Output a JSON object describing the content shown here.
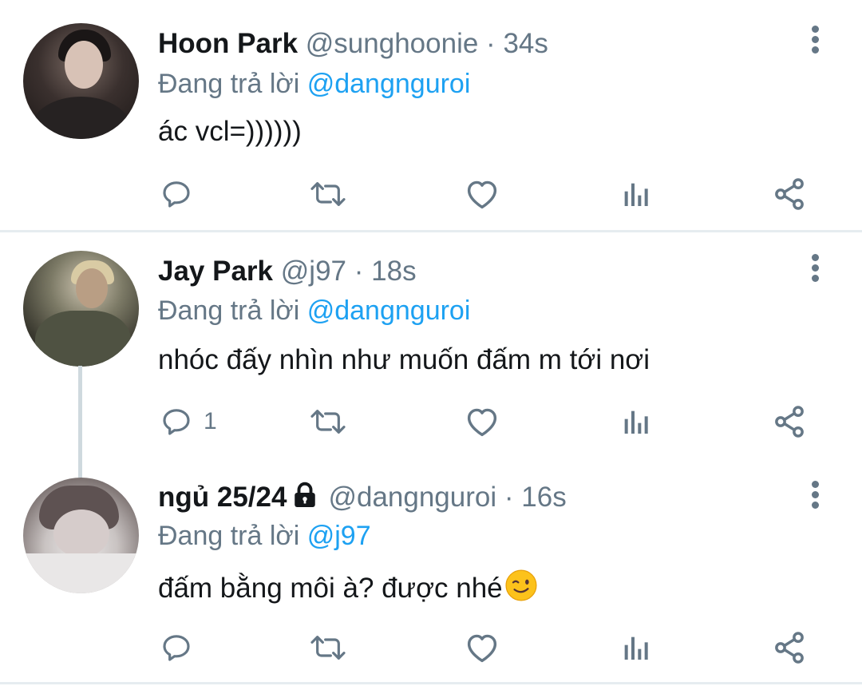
{
  "colors": {
    "text": "#14171a",
    "secondary": "#657786",
    "link": "#1da1f2",
    "divider": "#e6ecf0"
  },
  "tweets": [
    {
      "name": "Hoon Park",
      "handle": "@sunghoonie",
      "separator": "·",
      "time": "34s",
      "reply_prefix": "Đang trả lời",
      "reply_to": "@dangnguroi",
      "text": "ác vcl=))))))",
      "reply_count": ""
    },
    {
      "name": "Jay Park",
      "handle": "@j97",
      "separator": "·",
      "time": "18s",
      "reply_prefix": "Đang trả lời",
      "reply_to": "@dangnguroi",
      "text": "nhóc đấy nhìn như muốn đấm m tới nơi",
      "reply_count": "1"
    },
    {
      "name": "ngủ 25/24",
      "locked": true,
      "handle": "@dangnguroi",
      "separator": "·",
      "time": "16s",
      "reply_prefix": "Đang trả lời",
      "reply_to": "@j97",
      "text": "đấm bằng môi à? được nhé",
      "emoji": "winking-face",
      "reply_count": ""
    }
  ],
  "icons": [
    "reply-icon",
    "retweet-icon",
    "like-icon",
    "analytics-icon",
    "share-icon",
    "more-options-icon",
    "lock-icon"
  ]
}
